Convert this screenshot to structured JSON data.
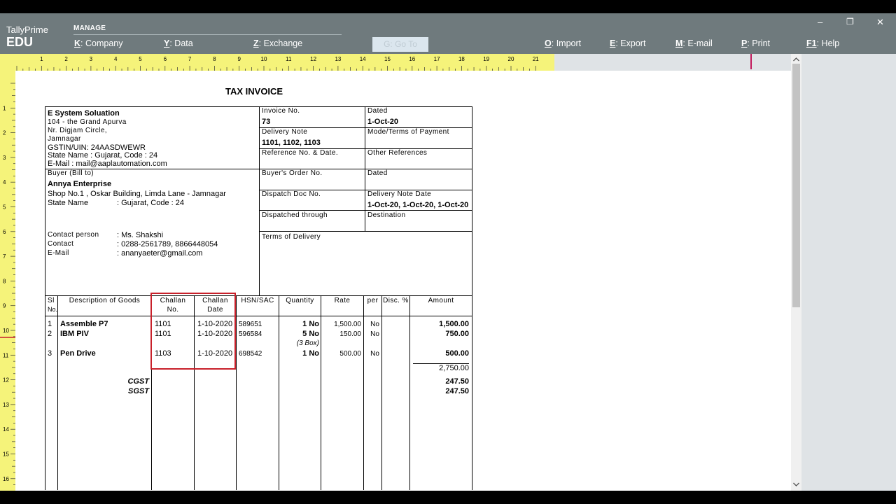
{
  "app": {
    "title": "TallyPrime",
    "edition": "EDU"
  },
  "menu": {
    "section": "MANAGE",
    "items": [
      {
        "key": "K",
        "label": "Company"
      },
      {
        "key": "Y",
        "label": "Data"
      },
      {
        "key": "Z",
        "label": "Exchange"
      },
      {
        "key": "G",
        "label": "Go To"
      },
      {
        "key": "O",
        "label": "Import"
      },
      {
        "key": "E",
        "label": "Export"
      },
      {
        "key": "M",
        "label": "E-mail"
      },
      {
        "key": "P",
        "label": "Print"
      },
      {
        "key": "F1",
        "label": "Help"
      }
    ]
  },
  "window_controls": {
    "minimize": "–",
    "restore": "❐",
    "close": "✕"
  },
  "ruler": {
    "top": [
      "1",
      "2",
      "3",
      "4",
      "5",
      "6",
      "7",
      "8",
      "9",
      "10",
      "11",
      "12",
      "13",
      "14",
      "15",
      "16",
      "17",
      "18",
      "19",
      "20",
      "21"
    ],
    "left": [
      "1",
      "2",
      "3",
      "4",
      "5",
      "6",
      "7",
      "8",
      "9",
      "10",
      "11",
      "12",
      "13",
      "14",
      "15",
      "16"
    ]
  },
  "invoice": {
    "title": "TAX INVOICE",
    "seller": {
      "name": "E System Soluation",
      "line1": "104 - the Grand Apurva",
      "line2": "Nr. Digjam Circle,",
      "line3": "Jamnagar",
      "gstin": "GSTIN/UIN: 24AASDWEWR",
      "state": "State Name :  Gujarat, Code : 24",
      "email": "E-Mail : mail@aaplautomation.com"
    },
    "buyer": {
      "label": "Buyer (Bill to)",
      "name": "Annya Enterprise",
      "address": "Shop No.1 , Oskar Building, Limda Lane - Jamnagar",
      "state_label": "State Name",
      "state_value": ":  Gujarat, Code : 24",
      "contact_person_label": "Contact person",
      "contact_person_value": ":  Ms. Shakshi",
      "contact_label": "Contact",
      "contact_value": ":  0288-2561789, 8866448054",
      "email_label": "E-Mail",
      "email_value": ":  ananyaeter@gmail.com"
    },
    "meta": {
      "invoice_no_label": "Invoice No.",
      "invoice_no": "73",
      "dated_label": "Dated",
      "dated": "1-Oct-20",
      "delivery_note_label": "Delivery Note",
      "delivery_note": "1101, 1102, 1103",
      "payment_label": "Mode/Terms of Payment",
      "reference_label": "Reference No. & Date.",
      "other_ref_label": "Other References",
      "buyers_order_label": "Buyer's Order No.",
      "dated2_label": "Dated",
      "dispatch_doc_label": "Dispatch Doc No.",
      "delivery_note_date_label": "Delivery Note Date",
      "delivery_note_date": "1-Oct-20, 1-Oct-20, 1-Oct-20",
      "dispatched_through_label": "Dispatched through",
      "destination_label": "Destination",
      "terms_label": "Terms of Delivery"
    },
    "columns": {
      "sl": "Sl",
      "sl2": "No.",
      "description": "Description of Goods",
      "challan_no": "Challan",
      "challan_no2": "No.",
      "challan_date": "Challan",
      "challan_date2": "Date",
      "hsn": "HSN/SAC",
      "quantity": "Quantity",
      "rate": "Rate",
      "per": "per",
      "disc": "Disc. %",
      "amount": "Amount"
    },
    "rows": [
      {
        "sl": "1",
        "desc": "Assemble P7",
        "challan_no": "1101",
        "challan_date": "1-10-2020",
        "hsn": "589651",
        "qty": "1 No",
        "qty_note": "",
        "rate": "1,500.00",
        "per": "No",
        "amount": "1,500.00"
      },
      {
        "sl": "2",
        "desc": "IBM PIV",
        "challan_no": "1101",
        "challan_date": "1-10-2020",
        "hsn": "596584",
        "qty": "5 No",
        "qty_note": "(3 Box)",
        "rate": "150.00",
        "per": "No",
        "amount": "750.00"
      },
      {
        "sl": "3",
        "desc": "Pen Drive",
        "challan_no": "1103",
        "challan_date": "1-10-2020",
        "hsn": "698542",
        "qty": "1 No",
        "qty_note": "",
        "rate": "500.00",
        "per": "No",
        "amount": "500.00"
      }
    ],
    "subtotal": "2,750.00",
    "taxes": [
      {
        "name": "CGST",
        "amount": "247.50"
      },
      {
        "name": "SGST",
        "amount": "247.50"
      }
    ]
  }
}
